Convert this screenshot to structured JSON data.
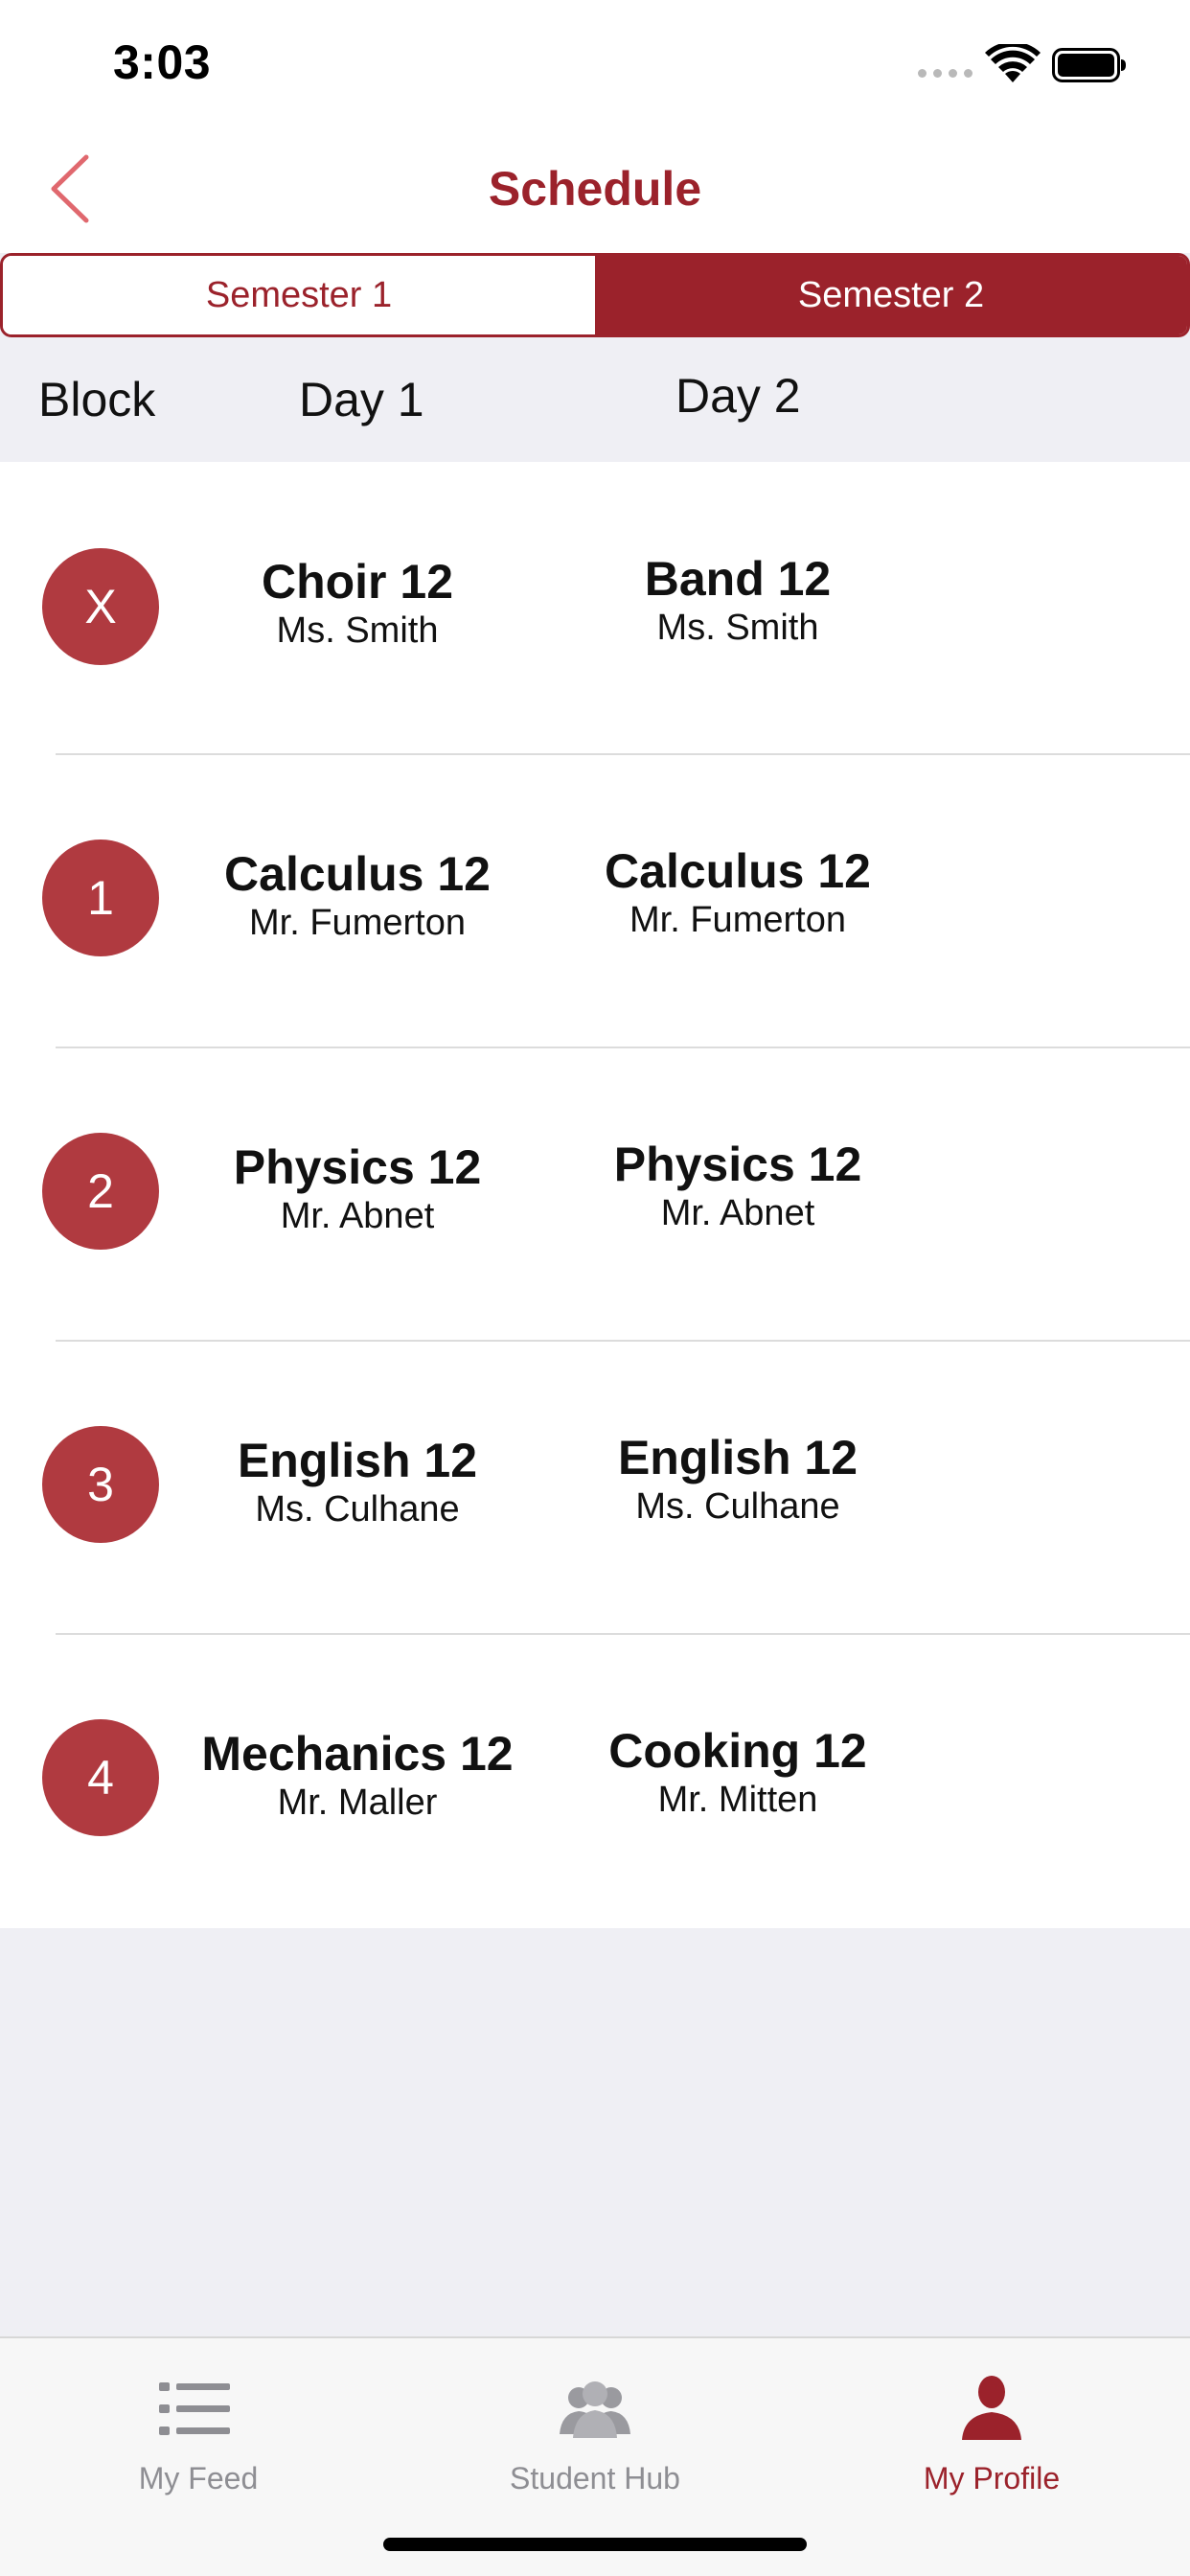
{
  "status_bar": {
    "time": "3:03"
  },
  "nav": {
    "title": "Schedule",
    "back_icon": "chevron-left-icon"
  },
  "segments": [
    {
      "label": "Semester 1",
      "selected": false
    },
    {
      "label": "Semester 2",
      "selected": true
    }
  ],
  "columns": {
    "block": "Block",
    "day1": "Day 1",
    "day2": "Day 2"
  },
  "rows": [
    {
      "block": "X",
      "day1": {
        "course": "Choir 12",
        "teacher": "Ms. Smith"
      },
      "day2": {
        "course": "Band 12",
        "teacher": "Ms. Smith"
      }
    },
    {
      "block": "1",
      "day1": {
        "course": "Calculus 12",
        "teacher": "Mr. Fumerton"
      },
      "day2": {
        "course": "Calculus 12",
        "teacher": "Mr. Fumerton"
      }
    },
    {
      "block": "2",
      "day1": {
        "course": "Physics 12",
        "teacher": "Mr. Abnet"
      },
      "day2": {
        "course": "Physics 12",
        "teacher": "Mr. Abnet"
      }
    },
    {
      "block": "3",
      "day1": {
        "course": "English 12",
        "teacher": "Ms. Culhane"
      },
      "day2": {
        "course": "English 12",
        "teacher": "Ms. Culhane"
      }
    },
    {
      "block": "4",
      "day1": {
        "course": "Mechanics 12",
        "teacher": "Mr. Maller"
      },
      "day2": {
        "course": "Cooking 12",
        "teacher": "Mr. Mitten"
      }
    }
  ],
  "tabs": [
    {
      "label": "My Feed",
      "icon": "list-icon",
      "active": false
    },
    {
      "label": "Student Hub",
      "icon": "people-icon",
      "active": false
    },
    {
      "label": "My Profile",
      "icon": "person-icon",
      "active": true
    }
  ],
  "colors": {
    "accent": "#9b222b",
    "badge": "#b03a40",
    "inactive_tab": "#8e8e93",
    "background": "#efeff4"
  }
}
